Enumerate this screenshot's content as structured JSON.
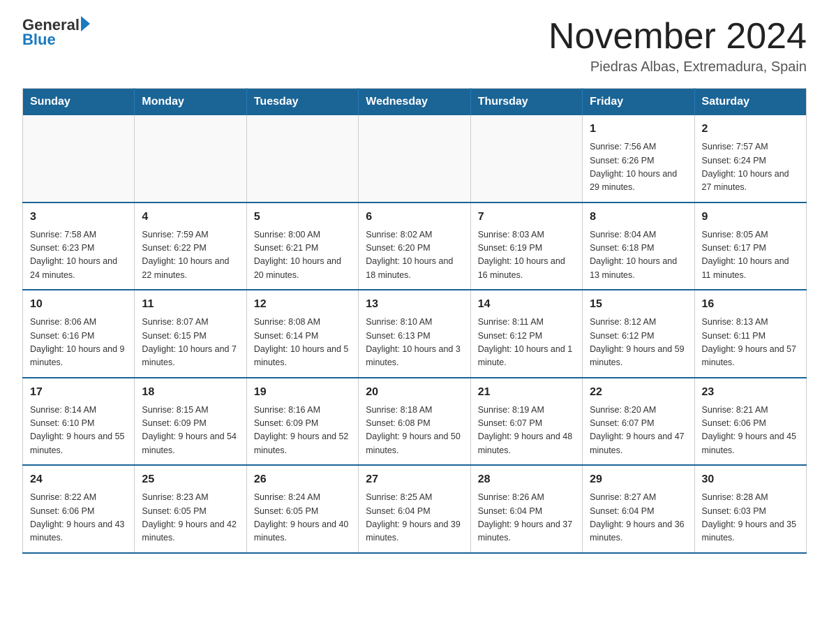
{
  "logo": {
    "line1": "General",
    "arrow": "▶",
    "line2": "Blue"
  },
  "title": "November 2024",
  "subtitle": "Piedras Albas, Extremadura, Spain",
  "weekdays": [
    "Sunday",
    "Monday",
    "Tuesday",
    "Wednesday",
    "Thursday",
    "Friday",
    "Saturday"
  ],
  "weeks": [
    [
      {
        "day": "",
        "info": ""
      },
      {
        "day": "",
        "info": ""
      },
      {
        "day": "",
        "info": ""
      },
      {
        "day": "",
        "info": ""
      },
      {
        "day": "",
        "info": ""
      },
      {
        "day": "1",
        "info": "Sunrise: 7:56 AM\nSunset: 6:26 PM\nDaylight: 10 hours and 29 minutes."
      },
      {
        "day": "2",
        "info": "Sunrise: 7:57 AM\nSunset: 6:24 PM\nDaylight: 10 hours and 27 minutes."
      }
    ],
    [
      {
        "day": "3",
        "info": "Sunrise: 7:58 AM\nSunset: 6:23 PM\nDaylight: 10 hours and 24 minutes."
      },
      {
        "day": "4",
        "info": "Sunrise: 7:59 AM\nSunset: 6:22 PM\nDaylight: 10 hours and 22 minutes."
      },
      {
        "day": "5",
        "info": "Sunrise: 8:00 AM\nSunset: 6:21 PM\nDaylight: 10 hours and 20 minutes."
      },
      {
        "day": "6",
        "info": "Sunrise: 8:02 AM\nSunset: 6:20 PM\nDaylight: 10 hours and 18 minutes."
      },
      {
        "day": "7",
        "info": "Sunrise: 8:03 AM\nSunset: 6:19 PM\nDaylight: 10 hours and 16 minutes."
      },
      {
        "day": "8",
        "info": "Sunrise: 8:04 AM\nSunset: 6:18 PM\nDaylight: 10 hours and 13 minutes."
      },
      {
        "day": "9",
        "info": "Sunrise: 8:05 AM\nSunset: 6:17 PM\nDaylight: 10 hours and 11 minutes."
      }
    ],
    [
      {
        "day": "10",
        "info": "Sunrise: 8:06 AM\nSunset: 6:16 PM\nDaylight: 10 hours and 9 minutes."
      },
      {
        "day": "11",
        "info": "Sunrise: 8:07 AM\nSunset: 6:15 PM\nDaylight: 10 hours and 7 minutes."
      },
      {
        "day": "12",
        "info": "Sunrise: 8:08 AM\nSunset: 6:14 PM\nDaylight: 10 hours and 5 minutes."
      },
      {
        "day": "13",
        "info": "Sunrise: 8:10 AM\nSunset: 6:13 PM\nDaylight: 10 hours and 3 minutes."
      },
      {
        "day": "14",
        "info": "Sunrise: 8:11 AM\nSunset: 6:12 PM\nDaylight: 10 hours and 1 minute."
      },
      {
        "day": "15",
        "info": "Sunrise: 8:12 AM\nSunset: 6:12 PM\nDaylight: 9 hours and 59 minutes."
      },
      {
        "day": "16",
        "info": "Sunrise: 8:13 AM\nSunset: 6:11 PM\nDaylight: 9 hours and 57 minutes."
      }
    ],
    [
      {
        "day": "17",
        "info": "Sunrise: 8:14 AM\nSunset: 6:10 PM\nDaylight: 9 hours and 55 minutes."
      },
      {
        "day": "18",
        "info": "Sunrise: 8:15 AM\nSunset: 6:09 PM\nDaylight: 9 hours and 54 minutes."
      },
      {
        "day": "19",
        "info": "Sunrise: 8:16 AM\nSunset: 6:09 PM\nDaylight: 9 hours and 52 minutes."
      },
      {
        "day": "20",
        "info": "Sunrise: 8:18 AM\nSunset: 6:08 PM\nDaylight: 9 hours and 50 minutes."
      },
      {
        "day": "21",
        "info": "Sunrise: 8:19 AM\nSunset: 6:07 PM\nDaylight: 9 hours and 48 minutes."
      },
      {
        "day": "22",
        "info": "Sunrise: 8:20 AM\nSunset: 6:07 PM\nDaylight: 9 hours and 47 minutes."
      },
      {
        "day": "23",
        "info": "Sunrise: 8:21 AM\nSunset: 6:06 PM\nDaylight: 9 hours and 45 minutes."
      }
    ],
    [
      {
        "day": "24",
        "info": "Sunrise: 8:22 AM\nSunset: 6:06 PM\nDaylight: 9 hours and 43 minutes."
      },
      {
        "day": "25",
        "info": "Sunrise: 8:23 AM\nSunset: 6:05 PM\nDaylight: 9 hours and 42 minutes."
      },
      {
        "day": "26",
        "info": "Sunrise: 8:24 AM\nSunset: 6:05 PM\nDaylight: 9 hours and 40 minutes."
      },
      {
        "day": "27",
        "info": "Sunrise: 8:25 AM\nSunset: 6:04 PM\nDaylight: 9 hours and 39 minutes."
      },
      {
        "day": "28",
        "info": "Sunrise: 8:26 AM\nSunset: 6:04 PM\nDaylight: 9 hours and 37 minutes."
      },
      {
        "day": "29",
        "info": "Sunrise: 8:27 AM\nSunset: 6:04 PM\nDaylight: 9 hours and 36 minutes."
      },
      {
        "day": "30",
        "info": "Sunrise: 8:28 AM\nSunset: 6:03 PM\nDaylight: 9 hours and 35 minutes."
      }
    ]
  ]
}
